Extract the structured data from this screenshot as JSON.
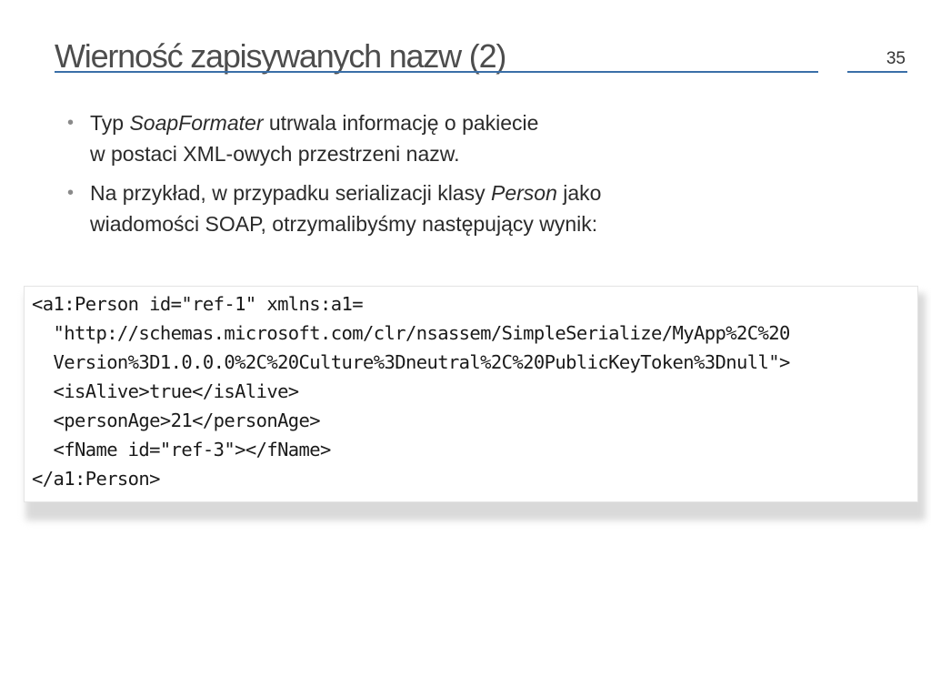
{
  "slide": {
    "title": "Wierność zapisywanych nazw  (2)",
    "number": "35"
  },
  "bullets": [
    {
      "line1_before": "Typ ",
      "line1_em": "SoapFormater",
      "line1_after": " utrwala informację o pakiecie",
      "line2": "w postaci XML-owych przestrzeni nazw."
    },
    {
      "line1_before": "Na przykład, w przypadku serializacji klasy ",
      "line1_em": "Person",
      "line1_after": " jako",
      "line2": "wiadomości SOAP, otrzymalibyśmy następujący wynik:"
    }
  ],
  "code_lines": [
    "<a1:Person id=\"ref-1\" xmlns:a1=",
    "  \"http://schemas.microsoft.com/clr/nsassem/SimpleSerialize/MyApp%2C%20",
    "  Version%3D1.0.0.0%2C%20Culture%3Dneutral%2C%20PublicKeyToken%3Dnull\">",
    "  <isAlive>true</isAlive>",
    "  <personAge>21</personAge>",
    "  <fName id=\"ref-3\"></fName>",
    "</a1:Person>"
  ]
}
